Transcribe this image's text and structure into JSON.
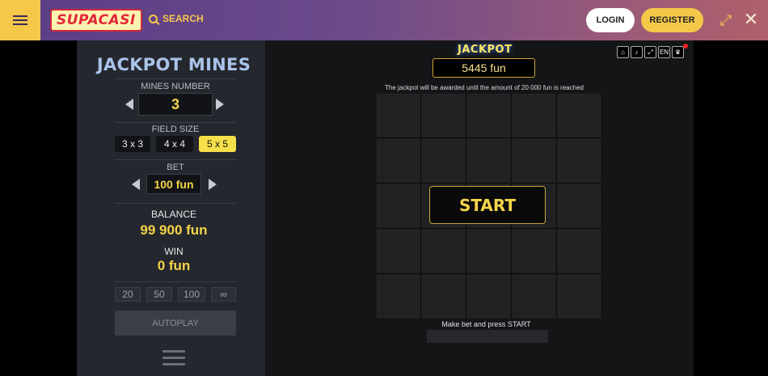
{
  "header": {
    "logo_text": "SUPACASI",
    "search_label": "SEARCH",
    "login_label": "LOGIN",
    "register_label": "REGISTER",
    "accent_color": "#f5c84a"
  },
  "side": {
    "title": "JACKPOT MINES",
    "mines_label": "MINES NUMBER",
    "mines_value": "3",
    "field_size_label": "FIELD SIZE",
    "field_sizes": [
      "3 x 3",
      "4 x 4",
      "5 x 5"
    ],
    "field_size_selected": "5 x 5",
    "bet_label": "BET",
    "bet_value": "100 fun",
    "balance_label": "BALANCE",
    "balance_value": "99 900 fun",
    "win_label": "WIN",
    "win_value": "0 fun",
    "auto_counts": [
      "20",
      "50",
      "100",
      "∞"
    ],
    "autoplay_label": "AUTOPLAY"
  },
  "game": {
    "jackpot_title": "JACKPOT",
    "jackpot_value": "5445 fun",
    "jackpot_note": "The jackpot will be awarded until the amount of 20 000 fun is reached",
    "start_label": "START",
    "status_text": "Make bet and press START",
    "language": "EN",
    "grid_size": 5,
    "tool_icons": [
      "home-icon",
      "sound-icon",
      "fullscreen-icon",
      "language-icon",
      "trophy-icon"
    ]
  }
}
